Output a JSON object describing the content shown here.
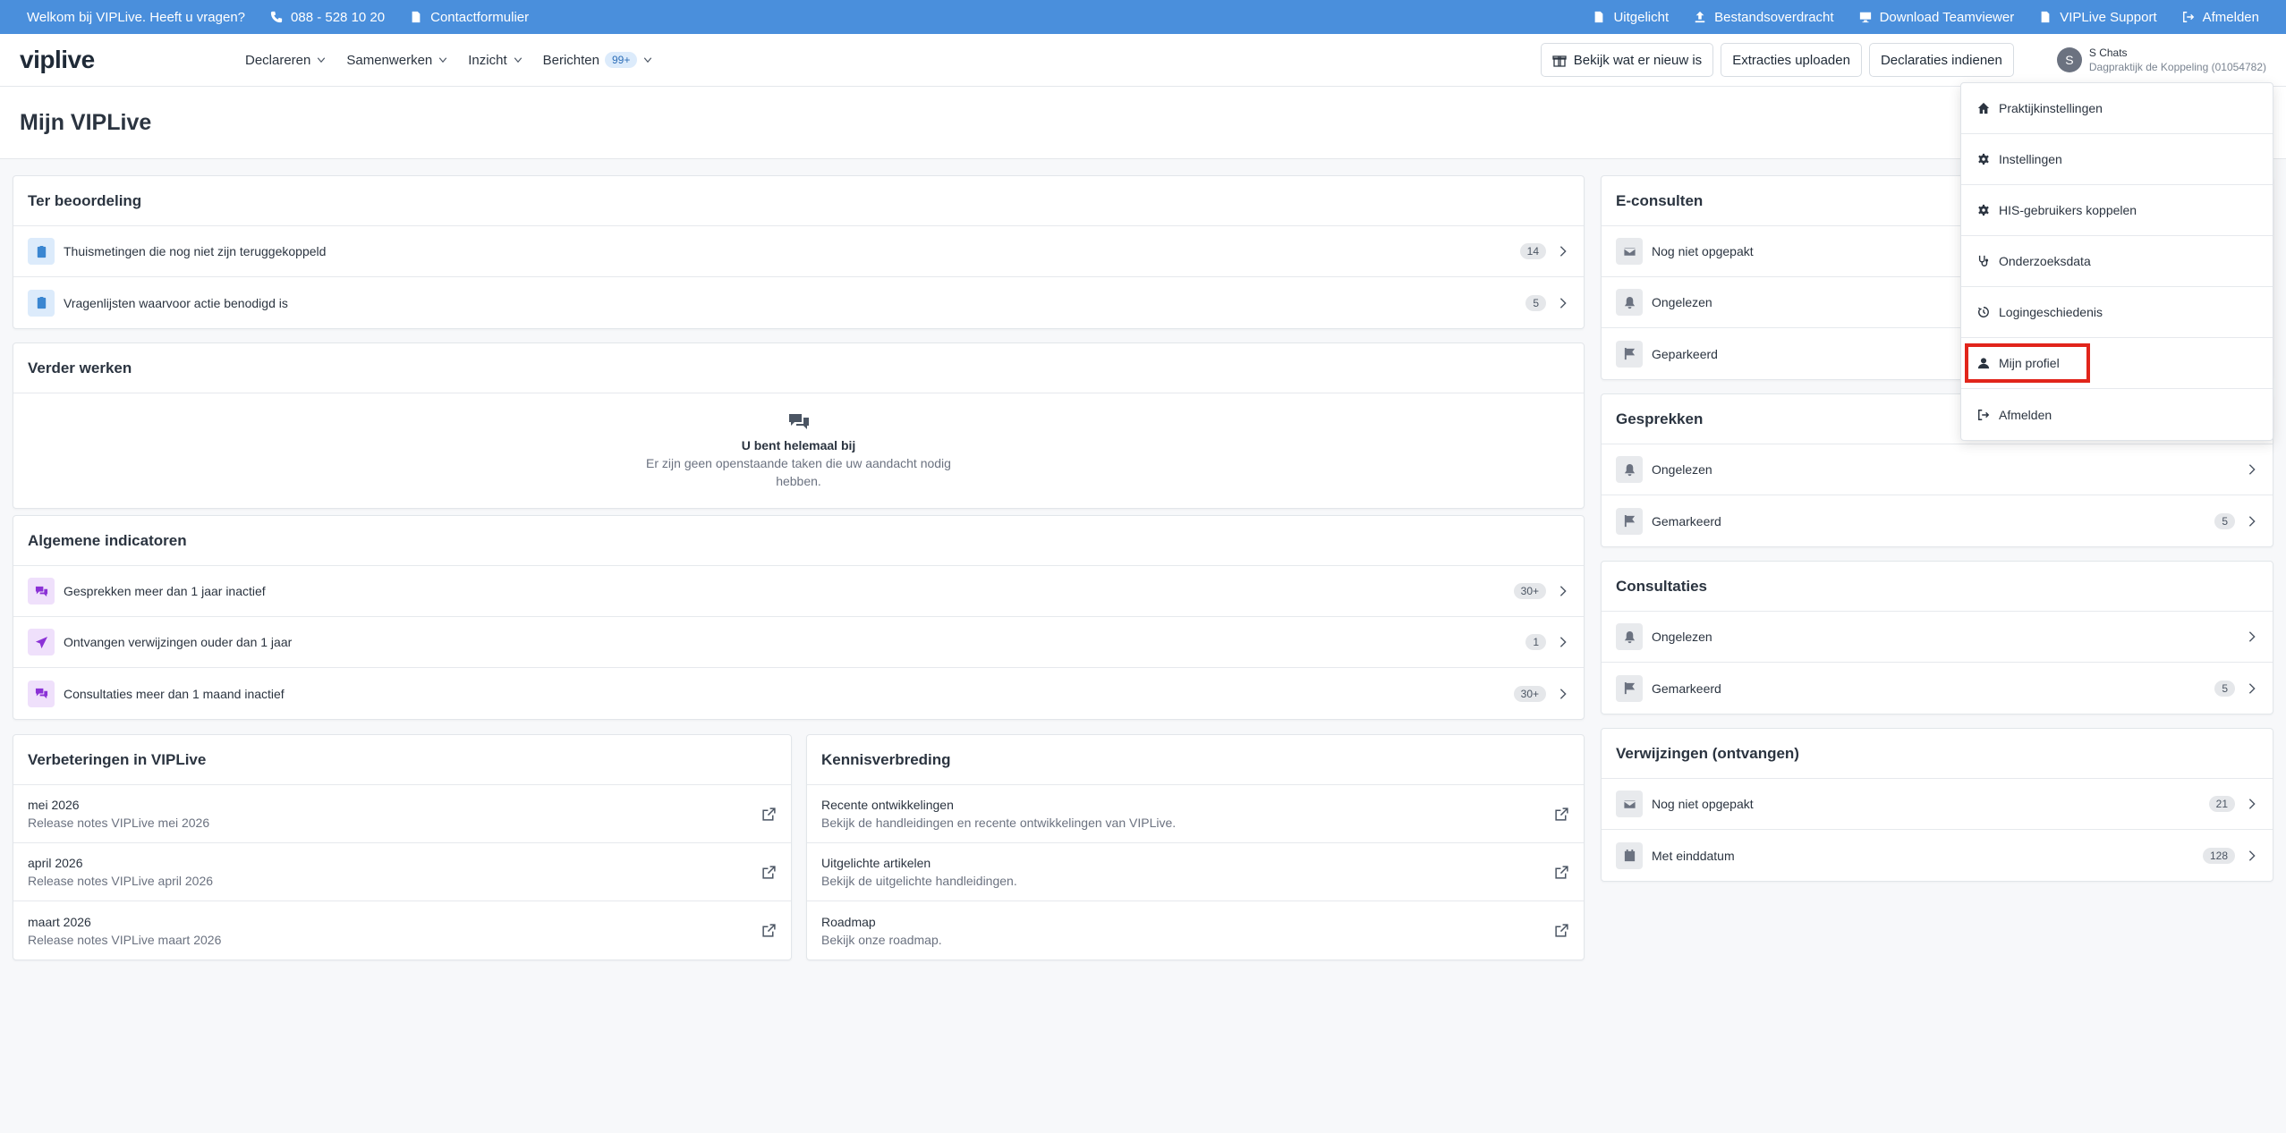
{
  "topbar": {
    "welcome": "Welkom bij VIPLive. Heeft u vragen?",
    "phone": "088 - 528 10 20",
    "contact": "Contactformulier",
    "links": [
      "Uitgelicht",
      "Bestandsoverdracht",
      "Download Teamviewer",
      "VIPLive Support",
      "Afmelden"
    ]
  },
  "header": {
    "logo_bold": "vip",
    "logo_rest": "live",
    "nav": [
      "Declareren",
      "Samenwerken",
      "Inzicht",
      "Berichten"
    ],
    "messages_badge": "99+",
    "buttons": [
      "Bekijk wat er nieuw is",
      "Extracties uploaden",
      "Declaraties indienen"
    ],
    "user_initial": "S",
    "user_name": "S Chats",
    "user_practice": "Dagpraktijk de Koppeling (01054782)"
  },
  "page": {
    "title": "Mijn VIPLive"
  },
  "ter_beoordeling": {
    "title": "Ter beoordeling",
    "rows": [
      {
        "label": "Thuismetingen die nog niet zijn teruggekoppeld",
        "count": "14"
      },
      {
        "label": "Vragenlijsten waarvoor actie benodigd is",
        "count": "5"
      }
    ]
  },
  "verder_werken": {
    "title": "Verder werken",
    "empty_title": "U bent helemaal bij",
    "empty_desc": "Er zijn geen openstaande taken die uw aandacht nodig hebben."
  },
  "indicatoren": {
    "title": "Algemene indicatoren",
    "rows": [
      {
        "label": "Gesprekken meer dan 1 jaar inactief",
        "count": "30+"
      },
      {
        "label": "Ontvangen verwijzingen ouder dan 1 jaar",
        "count": "1"
      },
      {
        "label": "Consultaties meer dan 1 maand inactief",
        "count": "30+"
      }
    ]
  },
  "verbeteringen": {
    "title": "Verbeteringen in VIPLive",
    "rows": [
      {
        "title": "mei 2026",
        "sub": "Release notes VIPLive mei 2026"
      },
      {
        "title": "april 2026",
        "sub": "Release notes VIPLive april 2026"
      },
      {
        "title": "maart 2026",
        "sub": "Release notes VIPLive maart 2026"
      }
    ]
  },
  "kennis": {
    "title": "Kennisverbreding",
    "rows": [
      {
        "title": "Recente ontwikkelingen",
        "sub": "Bekijk de handleidingen en recente ontwikkelingen van VIPLive."
      },
      {
        "title": "Uitgelichte artikelen",
        "sub": "Bekijk de uitgelichte handleidingen."
      },
      {
        "title": "Roadmap",
        "sub": "Bekijk onze roadmap."
      }
    ]
  },
  "econsulten": {
    "title": "E-consulten",
    "rows": [
      {
        "label": "Nog niet opgepakt",
        "count": ""
      },
      {
        "label": "Ongelezen",
        "count": ""
      },
      {
        "label": "Geparkeerd",
        "count": ""
      }
    ]
  },
  "gesprekken": {
    "title": "Gesprekken",
    "rows": [
      {
        "label": "Ongelezen",
        "count": ""
      },
      {
        "label": "Gemarkeerd",
        "count": "5"
      }
    ]
  },
  "consultaties": {
    "title": "Consultaties",
    "rows": [
      {
        "label": "Ongelezen",
        "count": ""
      },
      {
        "label": "Gemarkeerd",
        "count": "5"
      }
    ]
  },
  "verwijzingen": {
    "title": "Verwijzingen (ontvangen)",
    "rows": [
      {
        "label": "Nog niet opgepakt",
        "count": "21"
      },
      {
        "label": "Met einddatum",
        "count": "128"
      }
    ]
  },
  "dropdown": {
    "items": [
      "Praktijkinstellingen",
      "Instellingen",
      "HIS-gebruikers koppelen",
      "Onderzoeksdata",
      "Logingeschiedenis",
      "Mijn profiel",
      "Afmelden"
    ]
  }
}
